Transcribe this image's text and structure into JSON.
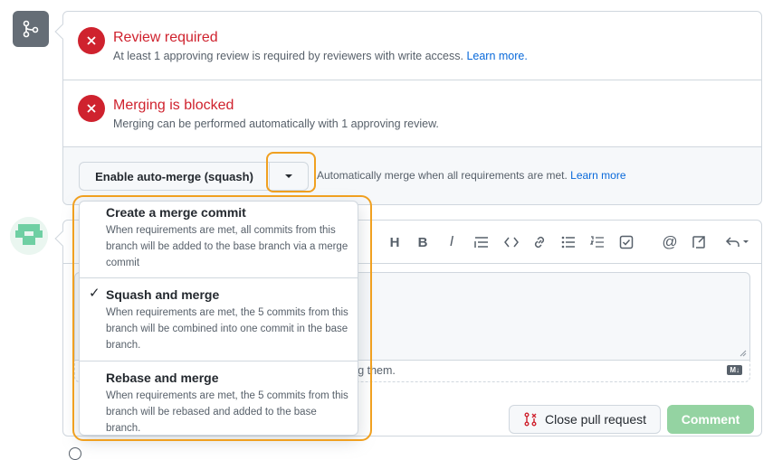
{
  "checks": [
    {
      "title": "Review required",
      "description": "At least 1 approving review is required by reviewers with write access.",
      "link": "Learn more."
    },
    {
      "title": "Merging is blocked",
      "description": "Merging can be performed automatically with 1 approving review."
    }
  ],
  "auto_merge": {
    "button_label": "Enable auto-merge (squash)",
    "hint": "Automatically merge when all requirements are met.",
    "hint_link": "Learn more"
  },
  "dropdown": {
    "items": [
      {
        "title": "Create a merge commit",
        "description": "When requirements are met, all commits from this branch will be added to the base branch via a merge commit",
        "selected": false
      },
      {
        "title": "Squash and merge",
        "description": "When requirements are met, the 5 commits from this branch will be combined into one commit in the base branch.",
        "selected": true
      },
      {
        "title": "Rebase and merge",
        "description": "When requirements are met, the 5 commits from this branch will be rebased and added to the base branch.",
        "selected": false
      }
    ],
    "check_mark": "✓"
  },
  "comment": {
    "hint_fragment": "ting them.",
    "markdown_badge": "M↓",
    "close_button": "Close pull request",
    "comment_button": "Comment"
  },
  "toolbar_icons": [
    "heading-icon",
    "bold-icon",
    "italic-icon",
    "quote-icon",
    "code-icon",
    "link-icon",
    "unordered-list-icon",
    "ordered-list-icon",
    "task-list-icon",
    "mention-icon",
    "reference-icon",
    "reply-icon"
  ],
  "colors": {
    "danger": "#cf222e",
    "accent": "#0969da",
    "highlight": "#f0a020",
    "success_disabled": "#94d3a2"
  }
}
